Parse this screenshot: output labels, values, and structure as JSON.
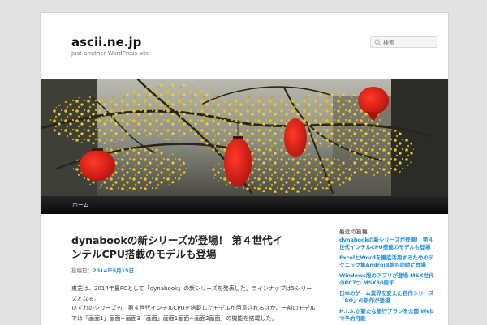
{
  "site": {
    "title": "ascii.ne.jp",
    "description": "Just another WordPress site"
  },
  "search": {
    "placeholder": "検索"
  },
  "nav": {
    "items": [
      {
        "label": "ホーム"
      }
    ]
  },
  "post": {
    "title": "dynabookの新シリーズが登場！ 第４世代インテルCPU搭載のモデルも登場",
    "meta_prefix": "投稿日：",
    "date": "2014年5月15日",
    "paragraphs": [
      "東芝は、2014年夏PCとして「dynabook」の新シリーズを発表した。ラインナップは5シリーズとなる。",
      "いずれのシリーズも、第４世代インテルCPUを搭載したモデルが用意されるほか、一部のモデルでは「画面1」画面+画面3「画面」画面1画面+画面2画面」の機能を搭載した。"
    ]
  },
  "sidebar": {
    "title": "最近の投稿",
    "recent": [
      "dynabookの新シリーズが登場！ 第４世代インテルCPU搭載のモデルも登場",
      "ExcelとWordを徹底活用するためのテクニック集Android版も同時に登場",
      "Windows版のアプリが登場 MSX世代のPC7つ MSX30周年",
      "日本のゲーム業界を変えた名作シリーズ「RO」の新作が登場",
      "H.I.S.が新たな旅行プランを公開 Webで予約可能"
    ]
  },
  "colors": {
    "link": "#1b8be0",
    "nav_bg": "#151515",
    "page_bg": "#e2e2e2"
  }
}
